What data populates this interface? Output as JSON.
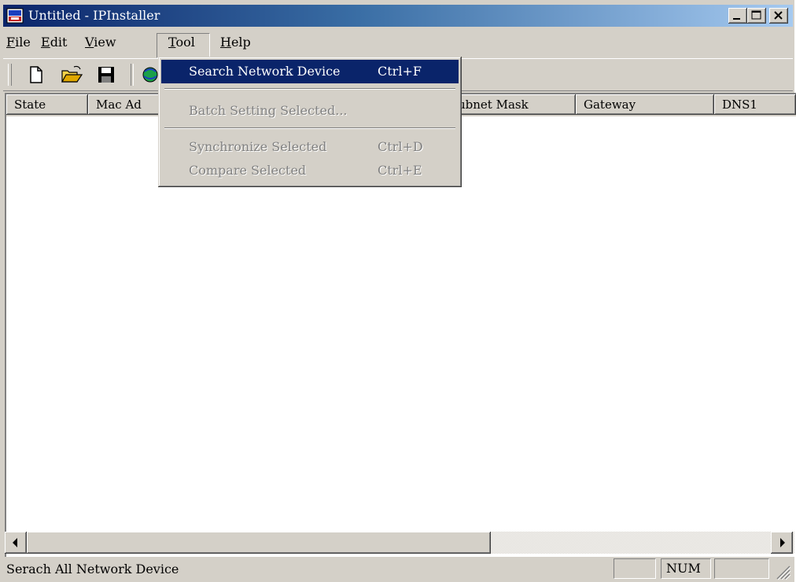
{
  "window": {
    "title": "Untitled - IPInstaller",
    "app_icon": "ipinstaller-app-icon",
    "title_gradient": [
      "#0a246a",
      "#a6caf0"
    ]
  },
  "menubar": {
    "items": [
      {
        "label": "File",
        "mnemonic": "F"
      },
      {
        "label": "Edit",
        "mnemonic": "E"
      },
      {
        "label": "View",
        "mnemonic": "V"
      },
      {
        "label": "Tool",
        "mnemonic": "T",
        "open": true
      },
      {
        "label": "Help",
        "mnemonic": "H"
      }
    ]
  },
  "toolbar": {
    "buttons": [
      "new-document-icon",
      "open-folder-icon",
      "save-disk-icon",
      "search-network-icon"
    ]
  },
  "list": {
    "columns": [
      "State",
      "Mac Ad",
      "ubnet Mask",
      "Gateway",
      "DNS1"
    ],
    "rows": []
  },
  "tool_menu": {
    "items": [
      {
        "label": "Search Network Device",
        "shortcut": "Ctrl+F",
        "enabled": true,
        "highlighted": true
      },
      {
        "label": "Batch Setting Selected...",
        "shortcut": "",
        "enabled": false
      },
      {
        "label": "Synchronize Selected",
        "shortcut": "Ctrl+D",
        "enabled": false
      },
      {
        "label": "Compare Selected",
        "shortcut": "Ctrl+E",
        "enabled": false
      }
    ],
    "highlight_color": "#0a246a"
  },
  "statusbar": {
    "message": "Serach All Network Device",
    "num_indicator": "NUM"
  }
}
